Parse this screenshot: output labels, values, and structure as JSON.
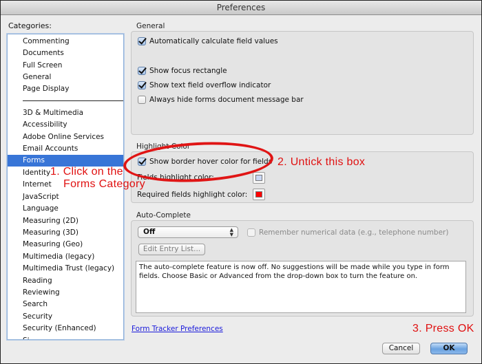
{
  "window": {
    "title": "Preferences"
  },
  "sidebar": {
    "label": "Categories:",
    "items_top": [
      "Commenting",
      "Documents",
      "Full Screen",
      "General",
      "Page Display"
    ],
    "items": [
      "3D & Multimedia",
      "Accessibility",
      "Adobe Online Services",
      "Email Accounts",
      "Forms",
      "Identity",
      "Internet",
      "JavaScript",
      "Language",
      "Measuring (2D)",
      "Measuring (3D)",
      "Measuring (Geo)",
      "Multimedia (legacy)",
      "Multimedia Trust (legacy)",
      "Reading",
      "Reviewing",
      "Search",
      "Security",
      "Security (Enhanced)",
      "Si..."
    ],
    "selected": "Forms",
    "selection_color": "#3875d7"
  },
  "general": {
    "title": "General",
    "options": [
      {
        "label": "Automatically calculate field values",
        "checked": true
      },
      {
        "label": "Show focus rectangle",
        "checked": true
      },
      {
        "label": "Show text field overflow indicator",
        "checked": true
      },
      {
        "label": "Always hide forms document message bar",
        "checked": false
      }
    ]
  },
  "highlight": {
    "title": "Highlight Color",
    "show_border_label": "Show border hover color for fields",
    "show_border_checked": true,
    "fields_label": "Fields highlight color:",
    "fields_color": "#c9d7f5",
    "required_label": "Required fields highlight color:",
    "required_color": "#ff0000"
  },
  "autocomplete": {
    "title": "Auto-Complete",
    "mode": "Off",
    "remember_label": "Remember numerical data (e.g., telephone number)",
    "remember_checked": false,
    "edit_button": "Edit Entry List...",
    "description": "The auto-complete feature is now off. No suggestions will be made while you type in form fields. Choose Basic or Advanced from the drop-down box to turn the feature on."
  },
  "footer": {
    "link": "Form Tracker Preferences",
    "cancel": "Cancel",
    "ok": "OK"
  },
  "annotations": {
    "step1_line1": "1. Click on the",
    "step1_line2": "Forms Category",
    "step2": "2. Untick this box",
    "step3": "3. Press OK",
    "color": "#e01010"
  }
}
